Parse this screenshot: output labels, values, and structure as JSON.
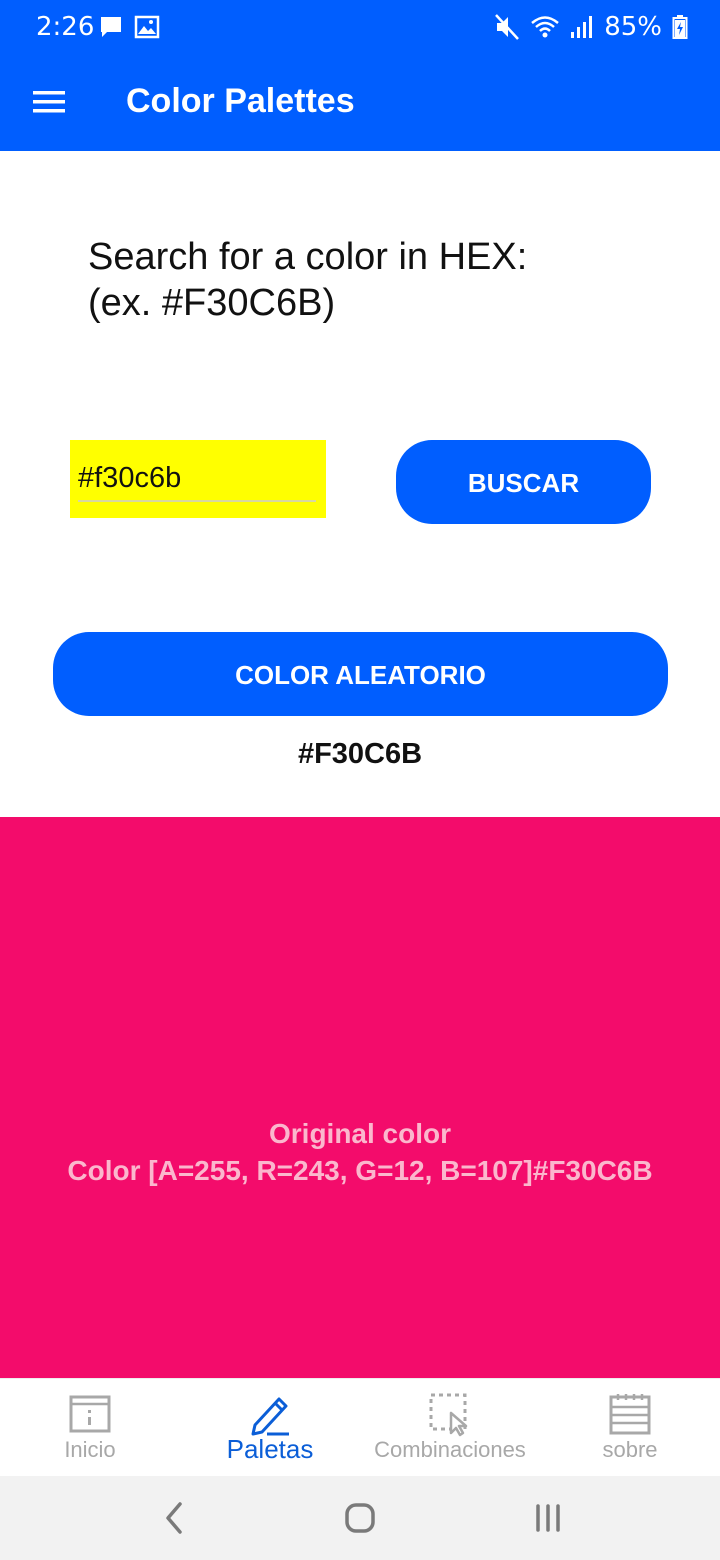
{
  "status_bar": {
    "time": "2:26",
    "battery": "85%",
    "left_icons": [
      "chat-icon",
      "image-icon"
    ],
    "right_icons": [
      "mute-icon",
      "wifi-icon",
      "signal-icon",
      "battery-icon"
    ]
  },
  "app_bar": {
    "title": "Color Palettes",
    "menu_icon": "hamburger-menu-icon",
    "background": "#005eff"
  },
  "search": {
    "prompt_line1": "Search for a color in HEX:",
    "prompt_line2": "(ex. #F30C6B)",
    "input_value": "#f30c6b",
    "input_background": "#ffff00",
    "search_button": "BUSCAR",
    "random_button": "COLOR ALEATORIO",
    "result_hex": "#F30C6B"
  },
  "swatch": {
    "color": "#f30c6b",
    "label": "Original color",
    "details": "Color [A=255, R=243, G=12, B=107]#F30C6B"
  },
  "bottom_nav": {
    "items": [
      {
        "label": "Inicio",
        "icon": "browser-window-icon",
        "active": false
      },
      {
        "label": "Paletas",
        "icon": "pencil-icon",
        "active": true
      },
      {
        "label": "Combinaciones",
        "icon": "select-cursor-icon",
        "active": false
      },
      {
        "label": "sobre",
        "icon": "list-icon",
        "active": false
      }
    ]
  },
  "system_nav": {
    "buttons": [
      "back-icon",
      "home-icon",
      "recents-icon"
    ]
  }
}
